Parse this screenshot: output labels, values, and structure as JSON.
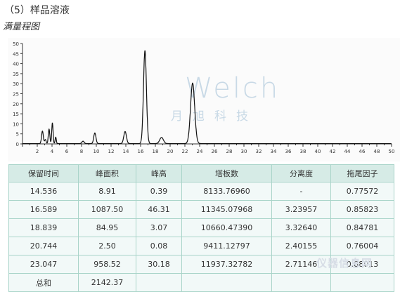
{
  "header": {
    "section_title": "（5）样品溶液",
    "subtitle": "满量程图"
  },
  "watermark": {
    "brand": "Welch",
    "brand_cn": "月旭科技",
    "corner": "仪器信息网"
  },
  "chart_data": {
    "type": "line",
    "title": "",
    "xlabel": "",
    "ylabel": "",
    "xlim": [
      0,
      50
    ],
    "ylim": [
      0,
      50
    ],
    "x_ticks": [
      2,
      4,
      6,
      8,
      10,
      12,
      14,
      16,
      18,
      20,
      22,
      24,
      26,
      28,
      30,
      32,
      34,
      36,
      38,
      40,
      42,
      44,
      46,
      48,
      50
    ],
    "y_ticks": [
      0,
      5,
      10,
      15,
      20,
      25,
      30,
      35,
      40,
      45,
      50
    ],
    "grid": false,
    "line_color": "#111111",
    "peaks": [
      {
        "x": 2.7,
        "y": 6.2,
        "w": 0.12
      },
      {
        "x": 3.1,
        "y": 2.0,
        "w": 0.1
      },
      {
        "x": 3.6,
        "y": 7.2,
        "w": 0.1
      },
      {
        "x": 4.05,
        "y": 10.3,
        "w": 0.09
      },
      {
        "x": 4.5,
        "y": 3.2,
        "w": 0.08
      },
      {
        "x": 8.2,
        "y": 1.2,
        "w": 0.15
      },
      {
        "x": 9.8,
        "y": 5.3,
        "w": 0.15
      },
      {
        "x": 13.9,
        "y": 6.0,
        "w": 0.18
      },
      {
        "x": 16.589,
        "y": 46.31,
        "w": 0.2
      },
      {
        "x": 18.839,
        "y": 3.07,
        "w": 0.25
      },
      {
        "x": 23.047,
        "y": 30.18,
        "w": 0.28
      }
    ]
  },
  "table": {
    "headers": [
      "保留时间",
      "峰面积",
      "峰高",
      "塔板数",
      "分离度",
      "拖尾因子"
    ],
    "rows": [
      [
        "14.536",
        "8.91",
        "0.39",
        "8133.76960",
        "-",
        "0.77572"
      ],
      [
        "16.589",
        "1087.50",
        "46.31",
        "11345.07968",
        "3.23957",
        "0.85823"
      ],
      [
        "18.839",
        "84.95",
        "3.07",
        "10660.47390",
        "3.32640",
        "0.84781"
      ],
      [
        "20.744",
        "2.50",
        "0.08",
        "9411.12797",
        "2.40155",
        "0.76004"
      ],
      [
        "23.047",
        "958.52",
        "30.18",
        "11937.32782",
        "2.71146",
        "0.88013"
      ],
      [
        "总和",
        "2142.37",
        "",
        "",
        "",
        ""
      ]
    ]
  }
}
